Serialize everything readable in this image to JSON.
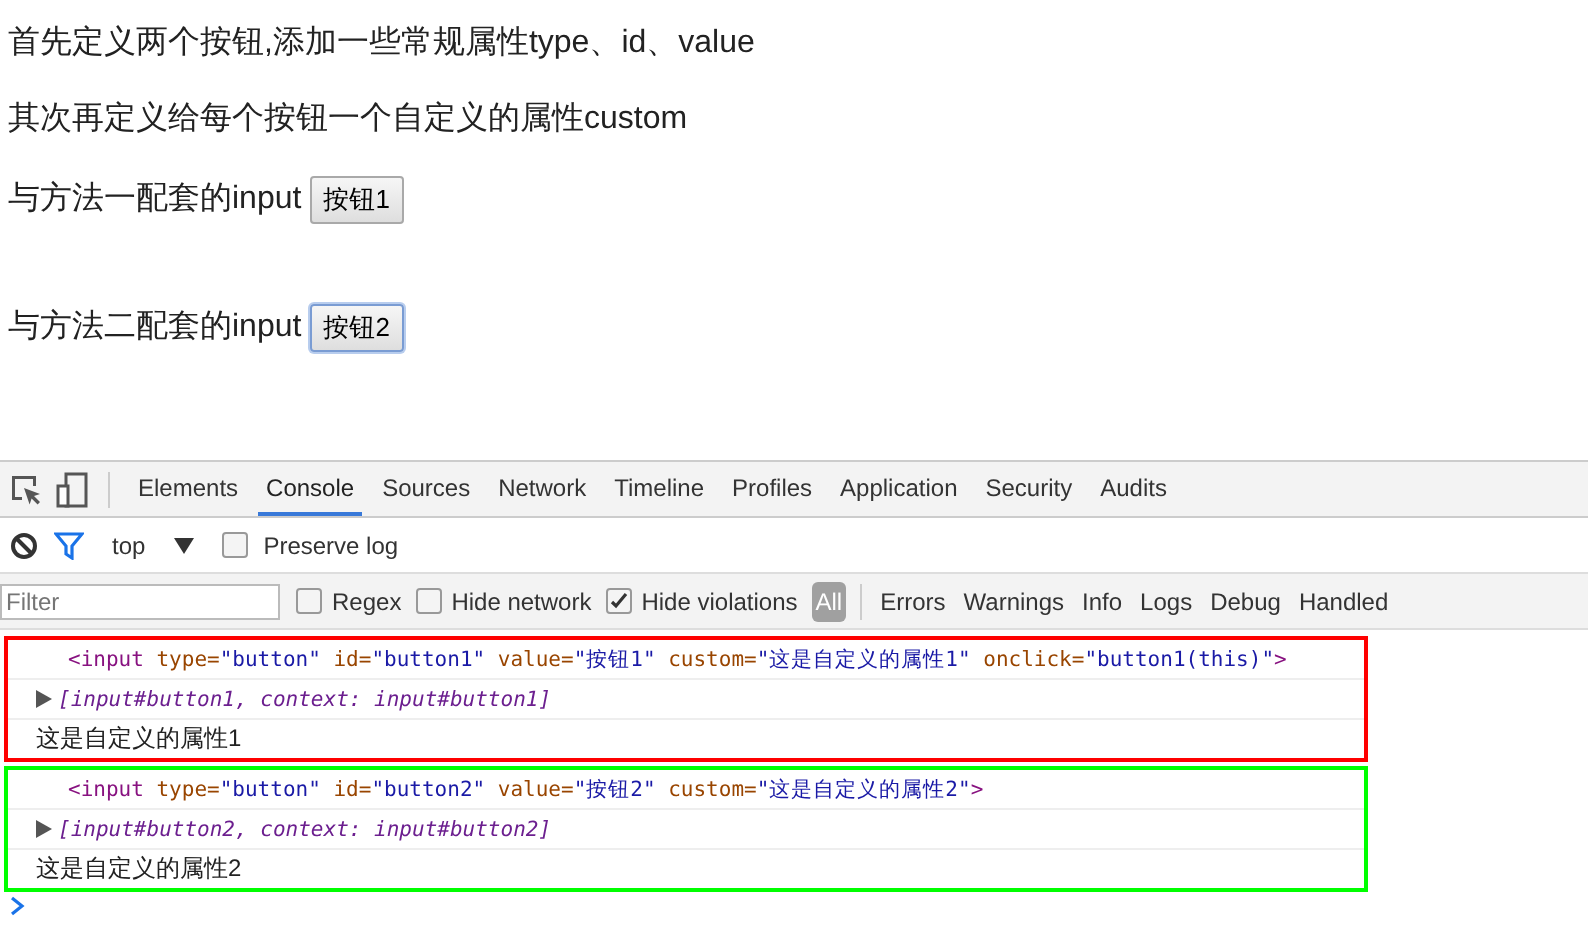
{
  "page": {
    "paragraphs": [
      "首先定义两个按钮,添加一些常规属性type、id、value",
      "其次再定义给每个按钮一个自定义的属性custom"
    ],
    "input_rows": [
      {
        "label": "与方法一配套的input",
        "button": "按钮1",
        "focused": false
      },
      {
        "label": "与方法二配套的input",
        "button": "按钮2",
        "focused": true
      }
    ]
  },
  "devtools": {
    "tabs": [
      {
        "label": "Elements",
        "selected": false
      },
      {
        "label": "Console",
        "selected": true
      },
      {
        "label": "Sources",
        "selected": false
      },
      {
        "label": "Network",
        "selected": false
      },
      {
        "label": "Timeline",
        "selected": false
      },
      {
        "label": "Profiles",
        "selected": false
      },
      {
        "label": "Application",
        "selected": false
      },
      {
        "label": "Security",
        "selected": false
      },
      {
        "label": "Audits",
        "selected": false
      }
    ],
    "context": "top",
    "preserve_log": {
      "label": "Preserve log",
      "checked": false
    },
    "filter": {
      "placeholder": "Filter"
    },
    "filter_options": [
      {
        "label": "Regex",
        "checked": false
      },
      {
        "label": "Hide network",
        "checked": false
      },
      {
        "label": "Hide violations",
        "checked": true
      }
    ],
    "levels": [
      {
        "label": "All",
        "selected": true
      },
      {
        "label": "Errors",
        "selected": false
      },
      {
        "label": "Warnings",
        "selected": false
      },
      {
        "label": "Info",
        "selected": false
      },
      {
        "label": "Logs",
        "selected": false
      },
      {
        "label": "Debug",
        "selected": false
      },
      {
        "label": "Handled",
        "selected": false
      }
    ],
    "console_groups": [
      {
        "color": "#ff0000",
        "element": {
          "open": "<input",
          "attrs": [
            {
              "name": "type=",
              "value": "\"button\""
            },
            {
              "name": "id=",
              "value": "\"button1\""
            },
            {
              "name": "value=",
              "value": "\"按钮1\""
            },
            {
              "name": "custom=",
              "value": "\"这是自定义的属性1\""
            },
            {
              "name": "onclick=",
              "value": "\"button1(this)\""
            }
          ],
          "close": ">"
        },
        "object": {
          "text": "[input#button1, context: input#button1]",
          "expanded": false
        },
        "log": "这是自定义的属性1"
      },
      {
        "color": "#00ff00",
        "element": {
          "open": "<input",
          "attrs": [
            {
              "name": "type=",
              "value": "\"button\""
            },
            {
              "name": "id=",
              "value": "\"button2\""
            },
            {
              "name": "value=",
              "value": "\"按钮2\""
            },
            {
              "name": "custom=",
              "value": "\"这是自定义的属性2\""
            }
          ],
          "close": ">"
        },
        "object": {
          "text": "[input#button2, context: input#button2]",
          "expanded": false
        },
        "log": "这是自定义的属性2"
      }
    ]
  }
}
